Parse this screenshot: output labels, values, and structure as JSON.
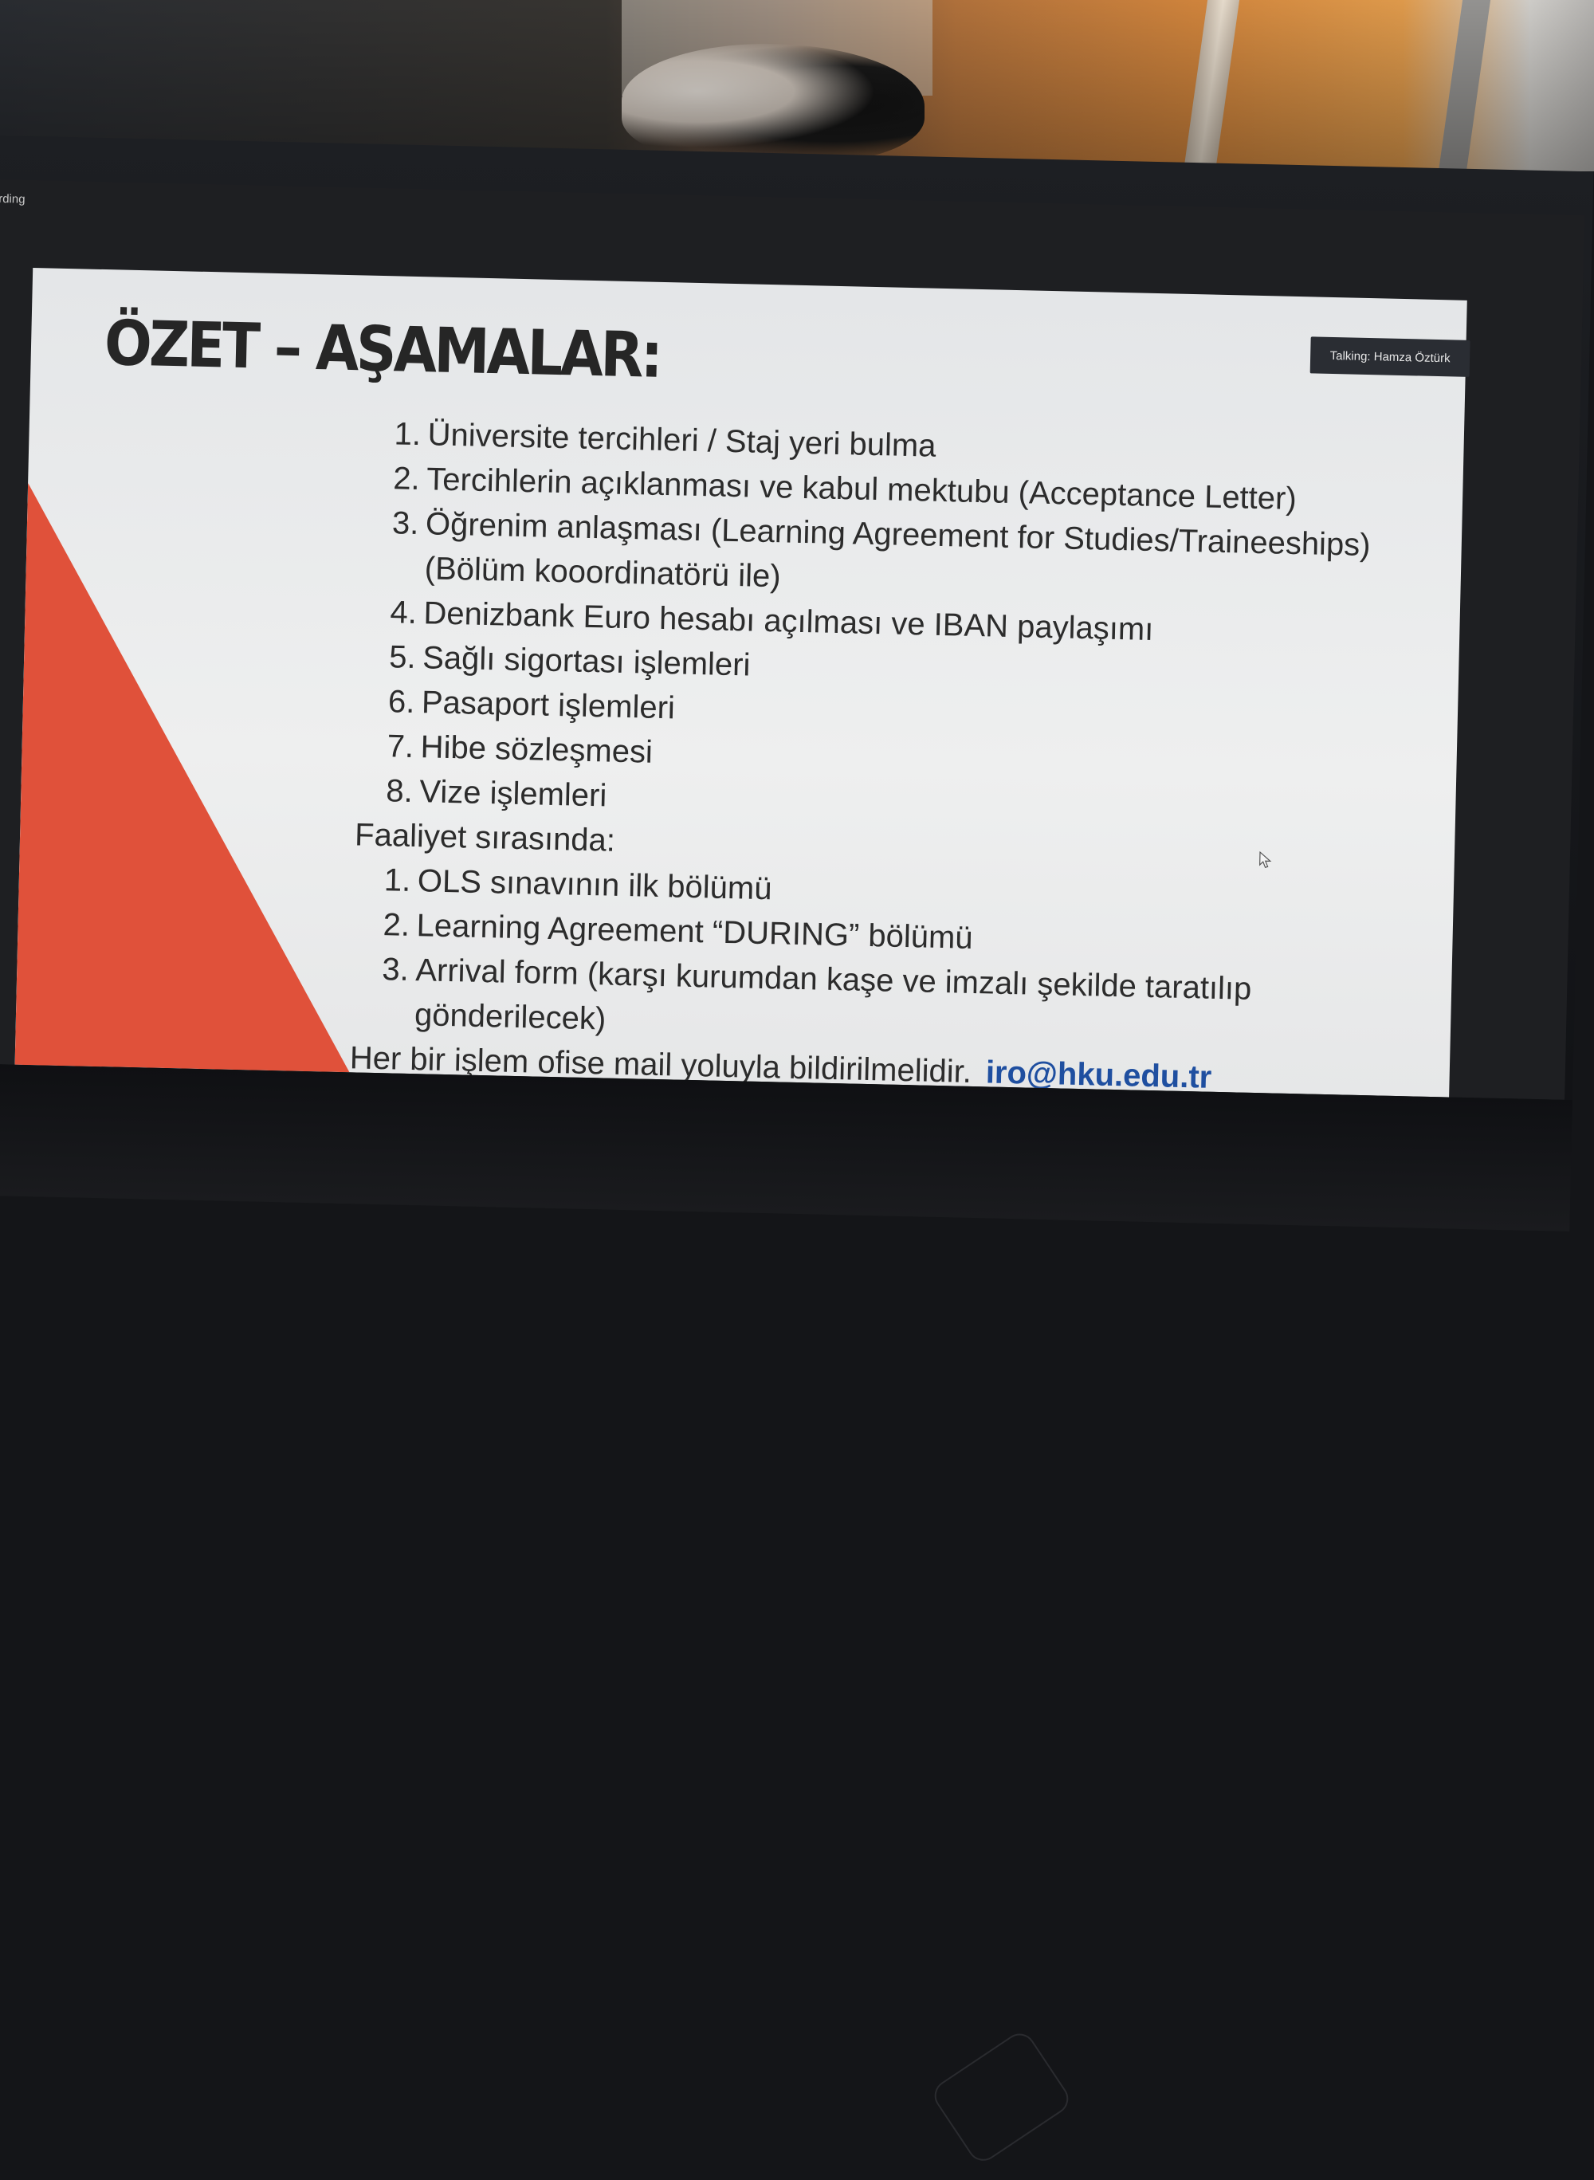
{
  "screen": {
    "recording_label": "rding",
    "talking_label": "Talking: Hamza Öztürk"
  },
  "slide": {
    "title": "ÖZET – AŞAMALAR:",
    "steps": [
      {
        "num": "1.",
        "text": "Üniversite tercihleri / Staj yeri bulma"
      },
      {
        "num": "2.",
        "text": "Tercihlerin açıklanması ve kabul mektubu (Acceptance Letter)"
      },
      {
        "num": "3.",
        "text": "Öğrenim anlaşması (Learning Agreement for Studies/Traineeships) (Bölüm kooordinatörü ile)"
      },
      {
        "num": "4.",
        "text": "Denizbank Euro hesabı açılması ve IBAN paylaşımı"
      },
      {
        "num": "5.",
        "text": "Sağlı sigortası işlemleri"
      },
      {
        "num": "6.",
        "text": "Pasaport işlemleri"
      },
      {
        "num": "7.",
        "text": "Hibe sözleşmesi"
      },
      {
        "num": "8.",
        "text": "Vize işlemleri"
      }
    ],
    "during_label": "Faaliyet sırasında:",
    "during_items": [
      {
        "num": "1.",
        "text": "OLS sınavının ilk bölümü"
      },
      {
        "num": "2.",
        "text": "Learning Agreement “DURING” bölümü"
      },
      {
        "num": "3.",
        "text": "Arrival form (karşı kurumdan kaşe ve imzalı şekilde taratılıp gönderilecek)"
      }
    ],
    "footer_text": "Her bir işlem ofise mail yoluyla bildirilmelidir.",
    "email": "iro@hku.edu.tr",
    "accent_color": "#e0513a",
    "email_color": "#1f4fa0"
  },
  "icons": {
    "cursor": "mouse-pointer-icon"
  }
}
